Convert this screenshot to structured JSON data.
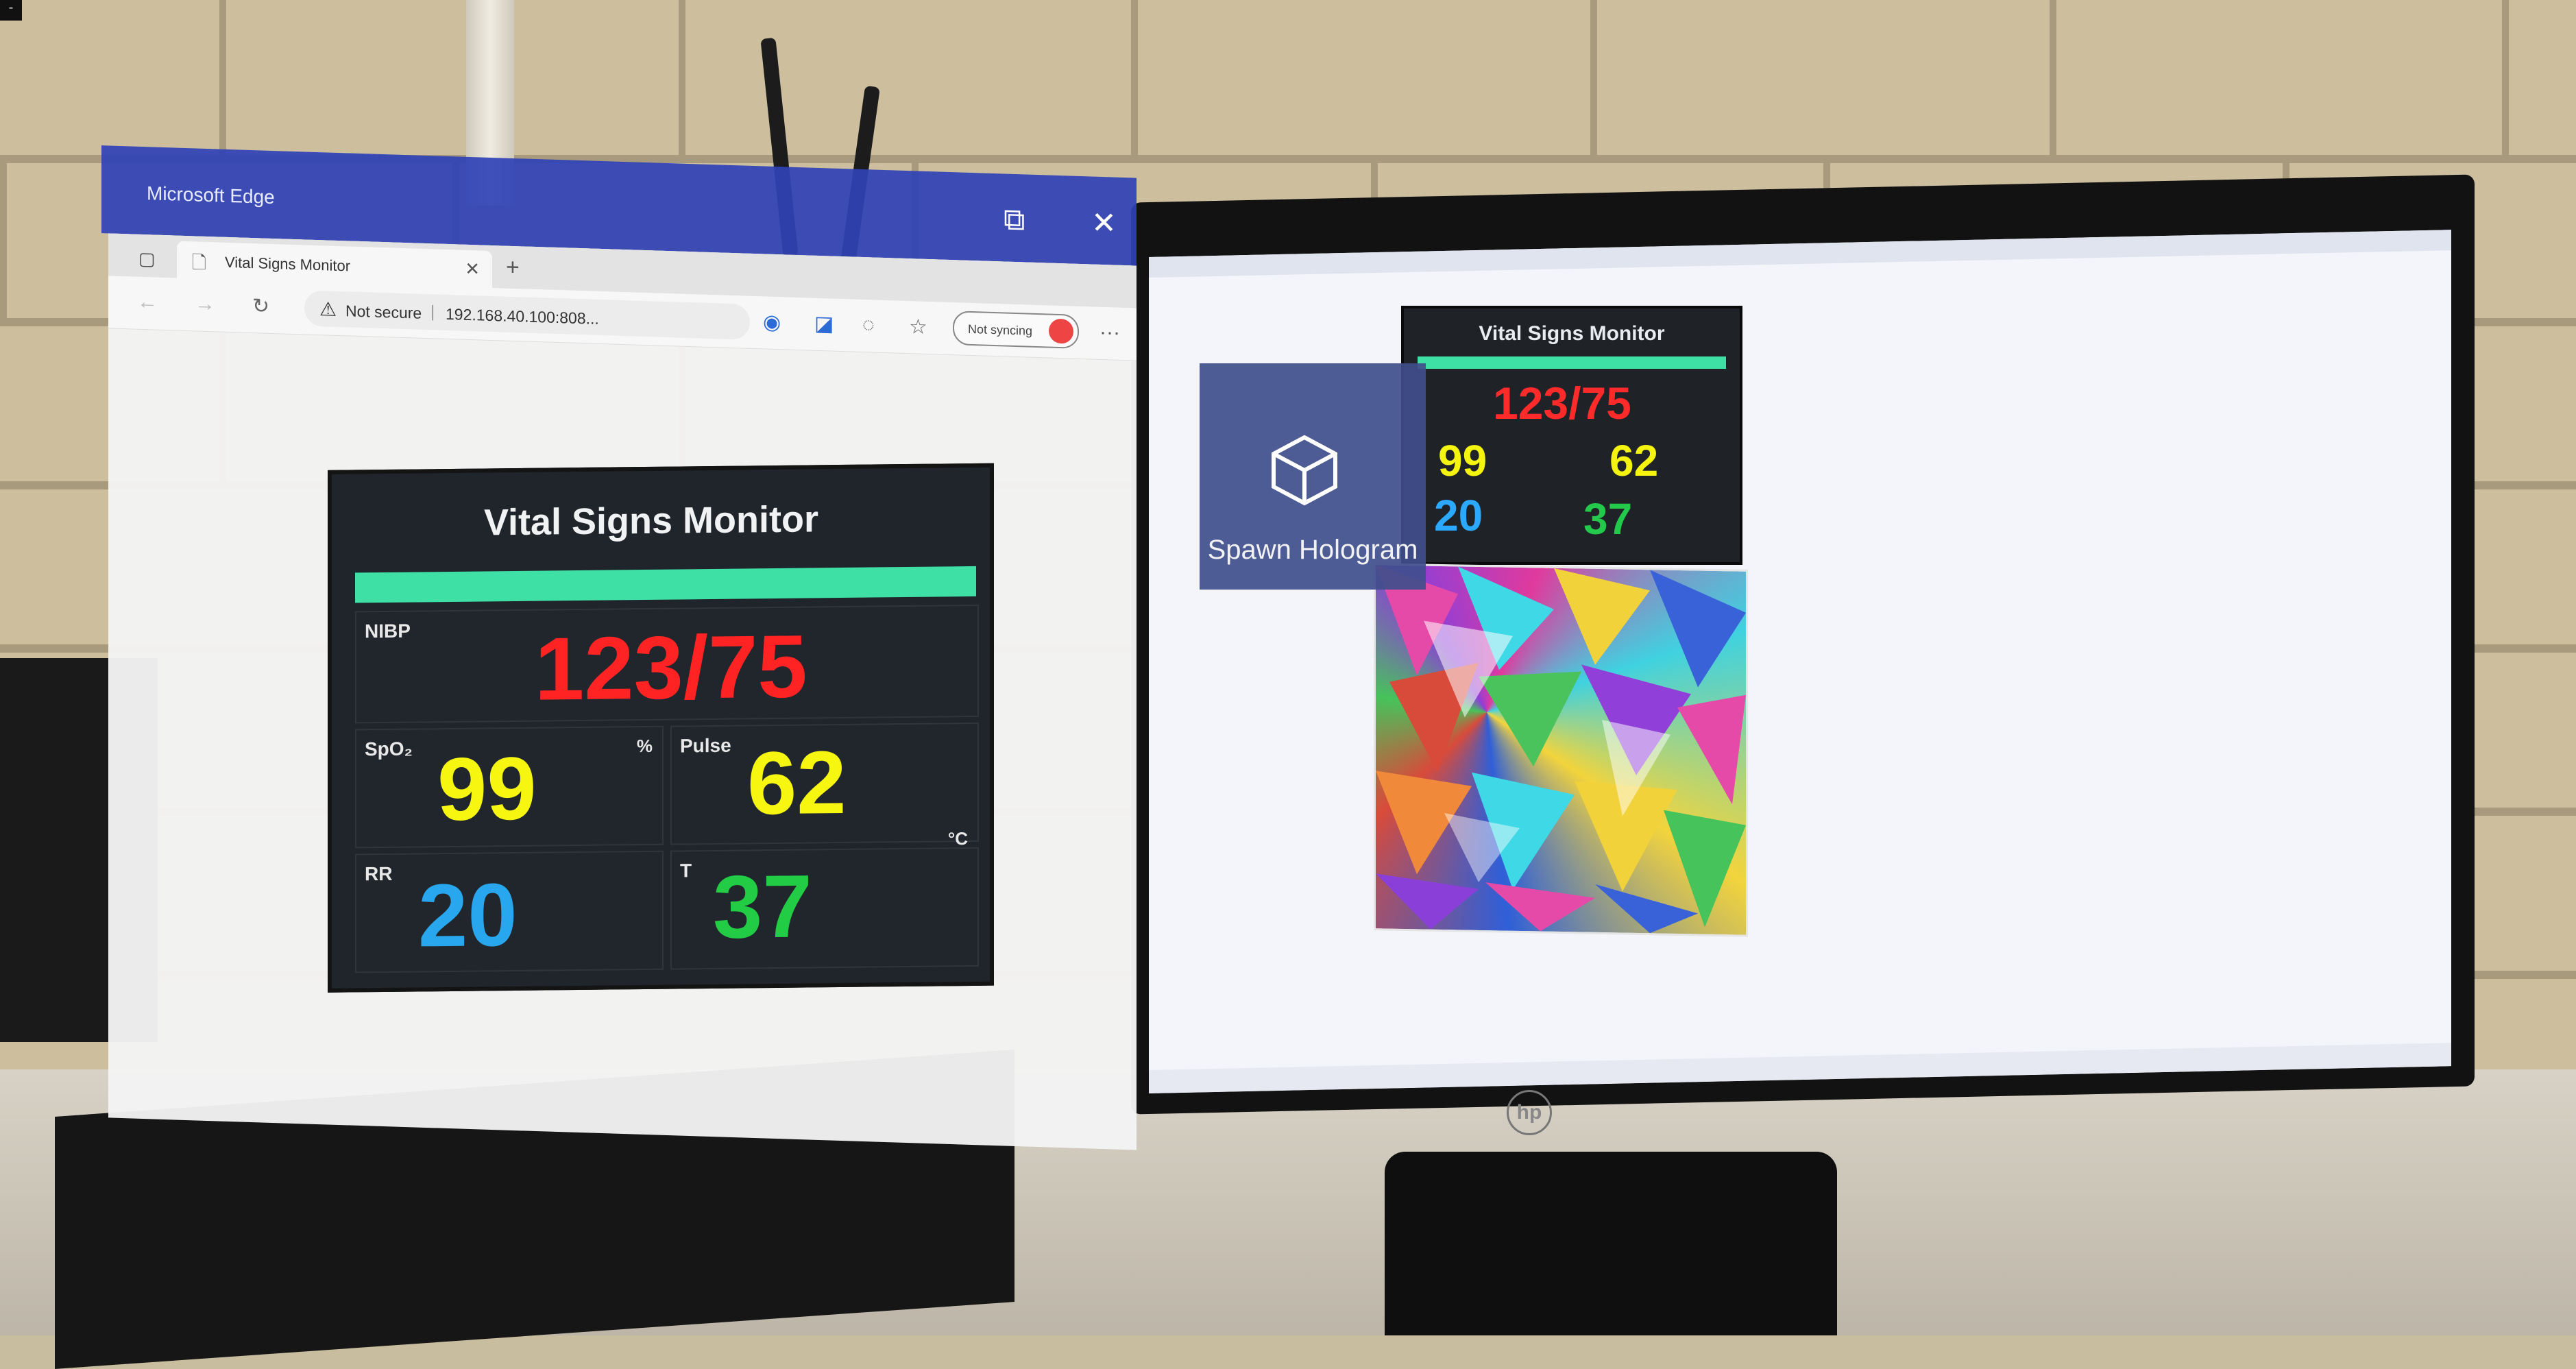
{
  "hologram_window": {
    "app_title": "Microsoft Edge",
    "tab_title": "Vital Signs Monitor",
    "address": {
      "security_label": "Not secure",
      "separator": "|",
      "url": "192.168.40.100:808..."
    },
    "sync_label": "Not syncing",
    "icons": {
      "restore": "⧉",
      "close": "✕",
      "tab_actions": "▢",
      "page": "🗋",
      "tab_close": "✕",
      "new_tab": "+",
      "back": "←",
      "forward": "→",
      "refresh": "↻",
      "warning": "⚠",
      "favorite": "☆",
      "more": "···"
    }
  },
  "vital_signs": {
    "title": "Vital Signs Monitor",
    "nibp_label": "NIBP",
    "nibp_value": "123/75",
    "spo2_label": "SpO₂",
    "spo2_value": "99",
    "spo2_unit": "%",
    "pulse_label": "Pulse",
    "pulse_value": "62",
    "rr_label": "RR",
    "rr_value": "20",
    "temp_label": "T",
    "temp_value": "37",
    "temp_unit": "°C",
    "colors": {
      "nibp": "#ff2323",
      "spo2": "#f6f610",
      "pulse": "#f6f610",
      "rr": "#28a7ee",
      "temp": "#22cc44",
      "bar": "#3ee0a6"
    }
  },
  "desktop_monitor": {
    "mini_title": "Vital Signs Monitor",
    "nibp_value": "123/75",
    "spo2_value": "99",
    "pulse_value": "62",
    "rr_value": "20",
    "temp_value": "37"
  },
  "spawn_tile": {
    "label": "Spawn Hologram",
    "icon": "cube-icon"
  },
  "hp_logo": "hp",
  "corner_glyph": "-"
}
